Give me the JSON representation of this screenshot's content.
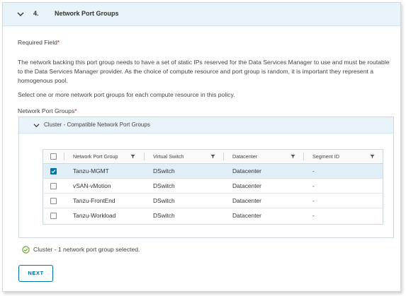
{
  "step": {
    "number": "4.",
    "title": "Network Port Groups"
  },
  "required_field": "Required Field",
  "required_mark": "*",
  "description": "The network backing this port group needs to have a set of static IPs reserved for the Data Services Manager to use and must be routable to the Data Services Manager provider. As the choice of compute resource and port group is random, it is important they represent a homogenous pool.",
  "instruction": "Select one or more network port groups for each compute resource in this policy.",
  "field_label": "Network Port Groups",
  "cluster": {
    "title": "Cluster - Compatible Network Port Groups"
  },
  "grid": {
    "columns": [
      "Network Port Group",
      "Virtual Switch",
      "Datacenter",
      "Segment ID"
    ],
    "rows": [
      {
        "name": "Tanzu-MGMT",
        "switch": "DSwitch",
        "datacenter": "Datacenter",
        "segment": "-",
        "selected": true
      },
      {
        "name": "vSAN-vMotion",
        "switch": "DSwitch",
        "datacenter": "Datacenter",
        "segment": "-",
        "selected": false
      },
      {
        "name": "Tanzu-FrontEnd",
        "switch": "DSwitch",
        "datacenter": "Datacenter",
        "segment": "-",
        "selected": false
      },
      {
        "name": "Tanzu-Workload",
        "switch": "DSwitch",
        "datacenter": "Datacenter",
        "segment": "-",
        "selected": false
      }
    ]
  },
  "status": "Cluster - 1 network port group selected.",
  "next_label": "NEXT",
  "colors": {
    "accent": "#0072a3",
    "success": "#5aa220",
    "required": "#c92100",
    "header_bg": "#e8f3fa"
  },
  "icons": [
    "chevron-down-icon",
    "filter-icon",
    "checkbox-icon",
    "check-circle-icon"
  ]
}
